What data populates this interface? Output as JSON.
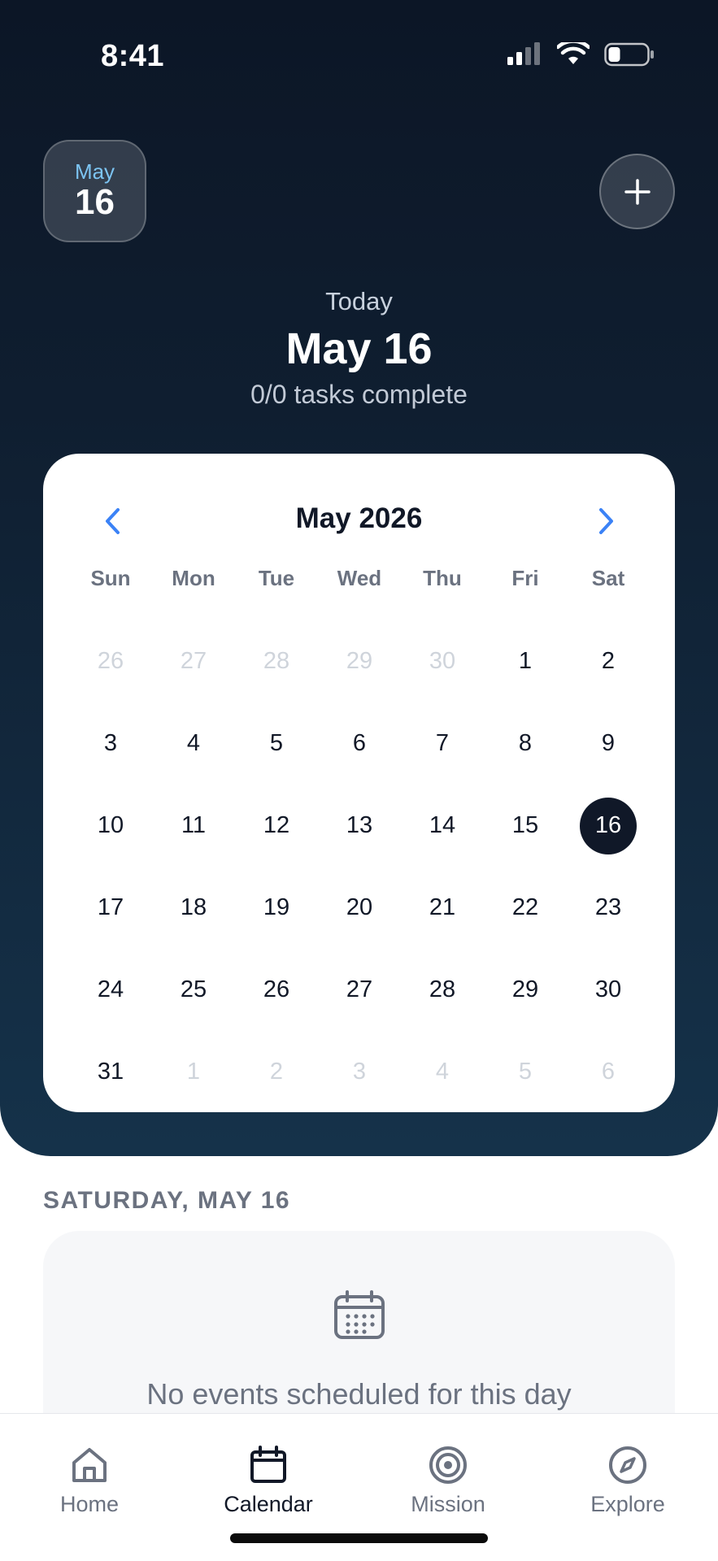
{
  "status_bar": {
    "time": "8:41"
  },
  "header": {
    "badge_month": "May",
    "badge_day": "16",
    "today_label": "Today",
    "today_date": "May 16",
    "tasks_summary": "0/0 tasks complete"
  },
  "calendar": {
    "title": "May 2026",
    "weekdays": [
      "Sun",
      "Mon",
      "Tue",
      "Wed",
      "Thu",
      "Fri",
      "Sat"
    ],
    "days": [
      {
        "n": "26",
        "muted": true
      },
      {
        "n": "27",
        "muted": true
      },
      {
        "n": "28",
        "muted": true
      },
      {
        "n": "29",
        "muted": true
      },
      {
        "n": "30",
        "muted": true
      },
      {
        "n": "1"
      },
      {
        "n": "2"
      },
      {
        "n": "3"
      },
      {
        "n": "4"
      },
      {
        "n": "5"
      },
      {
        "n": "6"
      },
      {
        "n": "7"
      },
      {
        "n": "8"
      },
      {
        "n": "9"
      },
      {
        "n": "10"
      },
      {
        "n": "11"
      },
      {
        "n": "12"
      },
      {
        "n": "13"
      },
      {
        "n": "14"
      },
      {
        "n": "15"
      },
      {
        "n": "16",
        "selected": true
      },
      {
        "n": "17"
      },
      {
        "n": "18"
      },
      {
        "n": "19"
      },
      {
        "n": "20"
      },
      {
        "n": "21"
      },
      {
        "n": "22"
      },
      {
        "n": "23"
      },
      {
        "n": "24"
      },
      {
        "n": "25"
      },
      {
        "n": "26"
      },
      {
        "n": "27"
      },
      {
        "n": "28"
      },
      {
        "n": "29"
      },
      {
        "n": "30"
      },
      {
        "n": "31"
      },
      {
        "n": "1",
        "muted": true
      },
      {
        "n": "2",
        "muted": true
      },
      {
        "n": "3",
        "muted": true
      },
      {
        "n": "4",
        "muted": true
      },
      {
        "n": "5",
        "muted": true
      },
      {
        "n": "6",
        "muted": true
      }
    ]
  },
  "day_section": {
    "label": "SATURDAY, MAY 16",
    "empty_text": "No events scheduled for this day"
  },
  "tabs": [
    {
      "label": "Home",
      "icon": "home-icon"
    },
    {
      "label": "Calendar",
      "icon": "calendar-icon",
      "active": true
    },
    {
      "label": "Mission",
      "icon": "target-icon"
    },
    {
      "label": "Explore",
      "icon": "compass-icon"
    }
  ],
  "colors": {
    "accent": "#3b82f6",
    "selected_day": "#101828",
    "badge_month": "#7cc4f2"
  }
}
